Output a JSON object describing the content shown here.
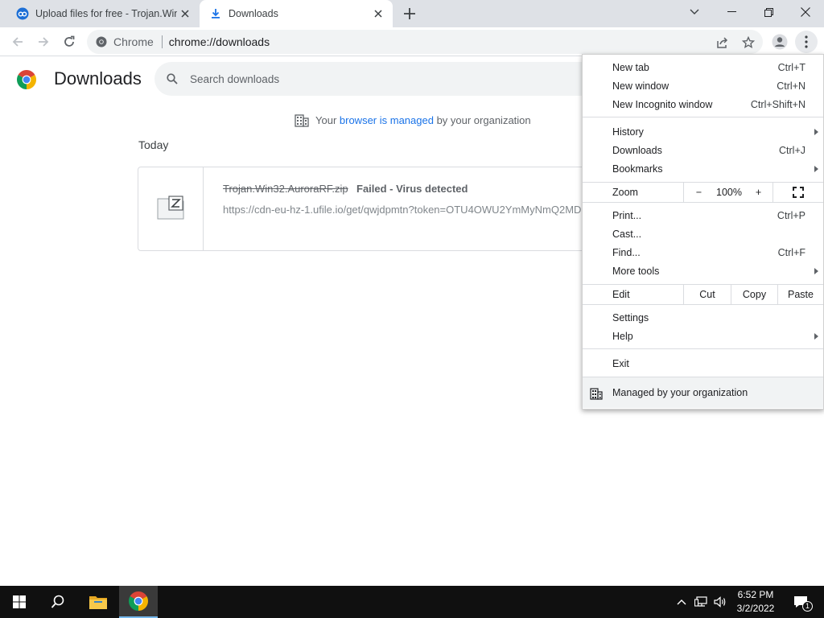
{
  "tabs": [
    {
      "title": "Upload files for free - Trojan.Win",
      "icon": "ufile-favicon"
    },
    {
      "title": "Downloads",
      "icon": "download-icon",
      "active": true
    }
  ],
  "toolbar": {
    "site_chip": "Chrome",
    "url": "chrome://downloads"
  },
  "page": {
    "title": "Downloads",
    "search_placeholder": "Search downloads",
    "managed_notice": {
      "prefix": "Your ",
      "link": "browser is managed",
      "suffix": " by your organization"
    },
    "section": "Today",
    "download": {
      "file_name": "Trojan.Win32.AuroraRF.zip",
      "status": "Failed - Virus detected",
      "url": "https://cdn-eu-hz-1.ufile.io/get/qwjdpmtn?token=OTU4OWU2YmMyNmQ2MD"
    }
  },
  "menu": {
    "group1": [
      {
        "label": "New tab",
        "shortcut": "Ctrl+T"
      },
      {
        "label": "New window",
        "shortcut": "Ctrl+N"
      },
      {
        "label": "New Incognito window",
        "shortcut": "Ctrl+Shift+N"
      }
    ],
    "group2": [
      {
        "label": "History",
        "shortcut": ""
      },
      {
        "label": "Downloads",
        "shortcut": "Ctrl+J"
      },
      {
        "label": "Bookmarks",
        "shortcut": ""
      }
    ],
    "zoom": {
      "label": "Zoom",
      "minus": "−",
      "value": "100%",
      "plus": "+"
    },
    "group3": [
      {
        "label": "Print...",
        "shortcut": "Ctrl+P"
      },
      {
        "label": "Cast...",
        "shortcut": ""
      },
      {
        "label": "Find...",
        "shortcut": "Ctrl+F"
      },
      {
        "label": "More tools",
        "shortcut": ""
      }
    ],
    "edit": {
      "label": "Edit",
      "cut": "Cut",
      "copy": "Copy",
      "paste": "Paste"
    },
    "group4": [
      {
        "label": "Settings"
      },
      {
        "label": "Help"
      }
    ],
    "exit": "Exit",
    "managed": "Managed by your organization"
  },
  "taskbar": {
    "time": "6:52 PM",
    "date": "3/2/2022",
    "notification_count": "1"
  },
  "colors": {
    "accent": "#1a73e8",
    "tabstrip": "#dee1e6",
    "taskbar": "#101010"
  }
}
